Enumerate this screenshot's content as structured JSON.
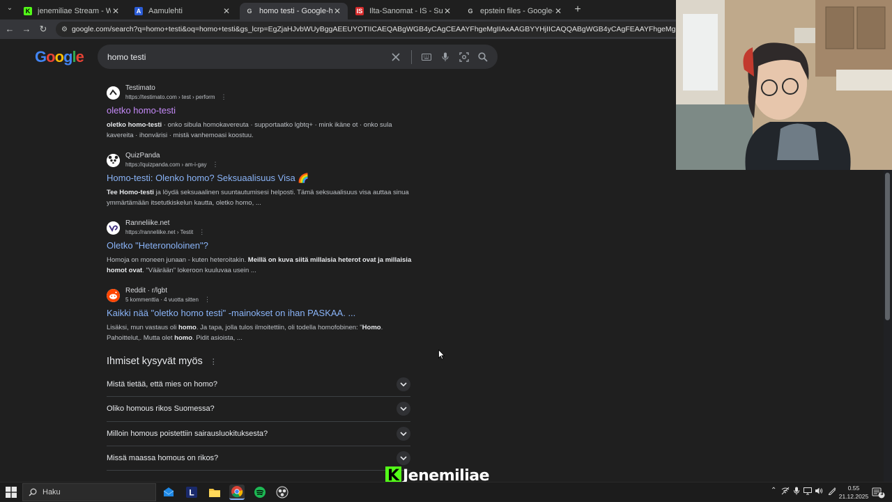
{
  "browser": {
    "tabs": [
      {
        "title": "jenemiliae Stream - Watch Live",
        "favicon": "kick-icon",
        "color": "#53fc18",
        "glyph": "K",
        "active": false
      },
      {
        "title": "Aamulehti",
        "favicon": "aamulehti-icon",
        "color": "#2b5cd6",
        "glyph": "A",
        "active": false
      },
      {
        "title": "homo testi - Google-haku",
        "favicon": "google-icon",
        "color": "#ffffff",
        "glyph": "G",
        "active": true
      },
      {
        "title": "Ilta-Sanomat - IS - Suomen suu",
        "favicon": "ilta-sanomat-icon",
        "color": "#d62b2b",
        "glyph": "IS",
        "active": false
      },
      {
        "title": "epstein files - Google-haku",
        "favicon": "google-icon",
        "color": "#ffffff",
        "glyph": "G",
        "active": false
      }
    ],
    "url": "google.com/search?q=homo+testi&oq=homo+testi&gs_lcrp=EgZjaHJvbWUyBggAEEUYOTIICAEQABgWGB4yCAgCEAAYFhgeMgIIAxAAGBYYHjIICAQQABgWGB4yCAgFEAAYFhgeMggIBhAAGBYYHjIICAcQABgWGB4"
  },
  "search": {
    "logo": "Google",
    "query": "homo testi"
  },
  "results": [
    {
      "site": "Testimato",
      "url": "https://testimato.com › test › perform",
      "title": "oletko homo-testi",
      "visited": true,
      "favicon": "testimato-icon",
      "snippet": [
        {
          "t": "oletko homo-testi",
          "b": true
        },
        {
          "t": " · onko sibula homokavereuta · supportaatko lgbtq+ · mink ikäne ot · onko sula kavereita · ihonvärisi · mistä vanhemoasi koostuu.",
          "b": false
        }
      ]
    },
    {
      "site": "QuizPanda",
      "url": "https://quizpanda.com › am-i-gay",
      "title": "Homo-testi: Olenko homo? Seksuaalisuus Visa 🌈",
      "visited": false,
      "favicon": "panda-icon",
      "snippet": [
        {
          "t": "Tee Homo-testi",
          "b": true
        },
        {
          "t": " ja löydä seksuaalinen suuntautumisesi helposti. Tämä seksuaalisuus visa auttaa sinua ymmärtämään itsetutkiskelun kautta, oletko homo, ...",
          "b": false
        }
      ]
    },
    {
      "site": "Ranneliike.net",
      "url": "https://ranneliike.net › Testit",
      "title": "Oletko \"Heteronoloinen\"?",
      "visited": false,
      "favicon": "ranneliike-icon",
      "snippet": [
        {
          "t": "Homoja on moneen junaan - kuten heteroitakin. ",
          "b": false
        },
        {
          "t": "Meillä on kuva siitä millaisia heterot ovat ja millaisia homot ovat",
          "b": true
        },
        {
          "t": ". \"Väärään\" lokeroon kuuluvaa usein ...",
          "b": false
        }
      ]
    },
    {
      "site": "Reddit · r/lgbt",
      "url": "5 kommenttia · 4 vuotta sitten",
      "title": "Kaikki nää \"oletko homo testi\" -mainokset on ihan PASKAA. ...",
      "visited": false,
      "favicon": "reddit-icon",
      "snippet": [
        {
          "t": "Lisäksi, mun vastaus oli ",
          "b": false
        },
        {
          "t": "homo",
          "b": true
        },
        {
          "t": ". Ja tapa, jolla tulos ilmoitettiin, oli todella homofobinen: \"",
          "b": false
        },
        {
          "t": "Homo",
          "b": true
        },
        {
          "t": ". Pahoittelut,. Mutta olet ",
          "b": false
        },
        {
          "t": "homo",
          "b": true
        },
        {
          "t": ". Pidit asioista, ...",
          "b": false
        }
      ]
    }
  ],
  "people_also_ask": {
    "title": "Ihmiset kysyvät myös",
    "questions": [
      "Mistä tietää, että mies on homo?",
      "Oliko homous rikos Suomessa?",
      "Milloin homous poistettiin sairausluokituksesta?",
      "Missä maassa homous on rikos?"
    ]
  },
  "stream_overlay": {
    "logo_letter": "K",
    "name": "Jenemiliae"
  },
  "taskbar": {
    "search_placeholder": "Haku",
    "time": "0.55",
    "date": "21.12.2025",
    "notification_count": "3"
  },
  "colors": {
    "link": "#8ab4f8",
    "visited": "#c58af9",
    "kick_green": "#53fc18"
  }
}
